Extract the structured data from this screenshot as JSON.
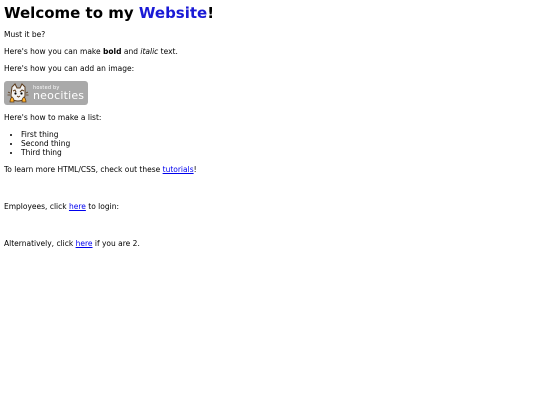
{
  "page": {
    "title_prefix": "Welcome to my ",
    "title_accent": "Website",
    "title_suffix": "!",
    "line1": "Must it be?",
    "line2_before": "Here's how you can make ",
    "line2_bold": "bold",
    "line2_middle": " and ",
    "line2_italic": "italic",
    "line2_after": " text.",
    "line3": "Here's how you can add an image:",
    "badge_small": "hosted by",
    "badge_big": "neocities",
    "list_intro": "Here's how to make a list:",
    "list_items": [
      "First thing",
      "Second thing",
      "Third thing"
    ],
    "learn_before": "To learn more HTML/CSS, check out these ",
    "learn_link": "tutorials",
    "learn_after": "!",
    "employees_before": "Employees, click ",
    "employees_link": "here",
    "employees_after": " to login:",
    "alt_before": "Alternatively, click ",
    "alt_link": "here",
    "alt_after": " if you are 2."
  },
  "colors": {
    "accent": "#1a1ad6",
    "link": "#0000ee",
    "badge_bg": "#a9a9a9"
  },
  "icons": {
    "badge": "neocities-cat-icon"
  }
}
